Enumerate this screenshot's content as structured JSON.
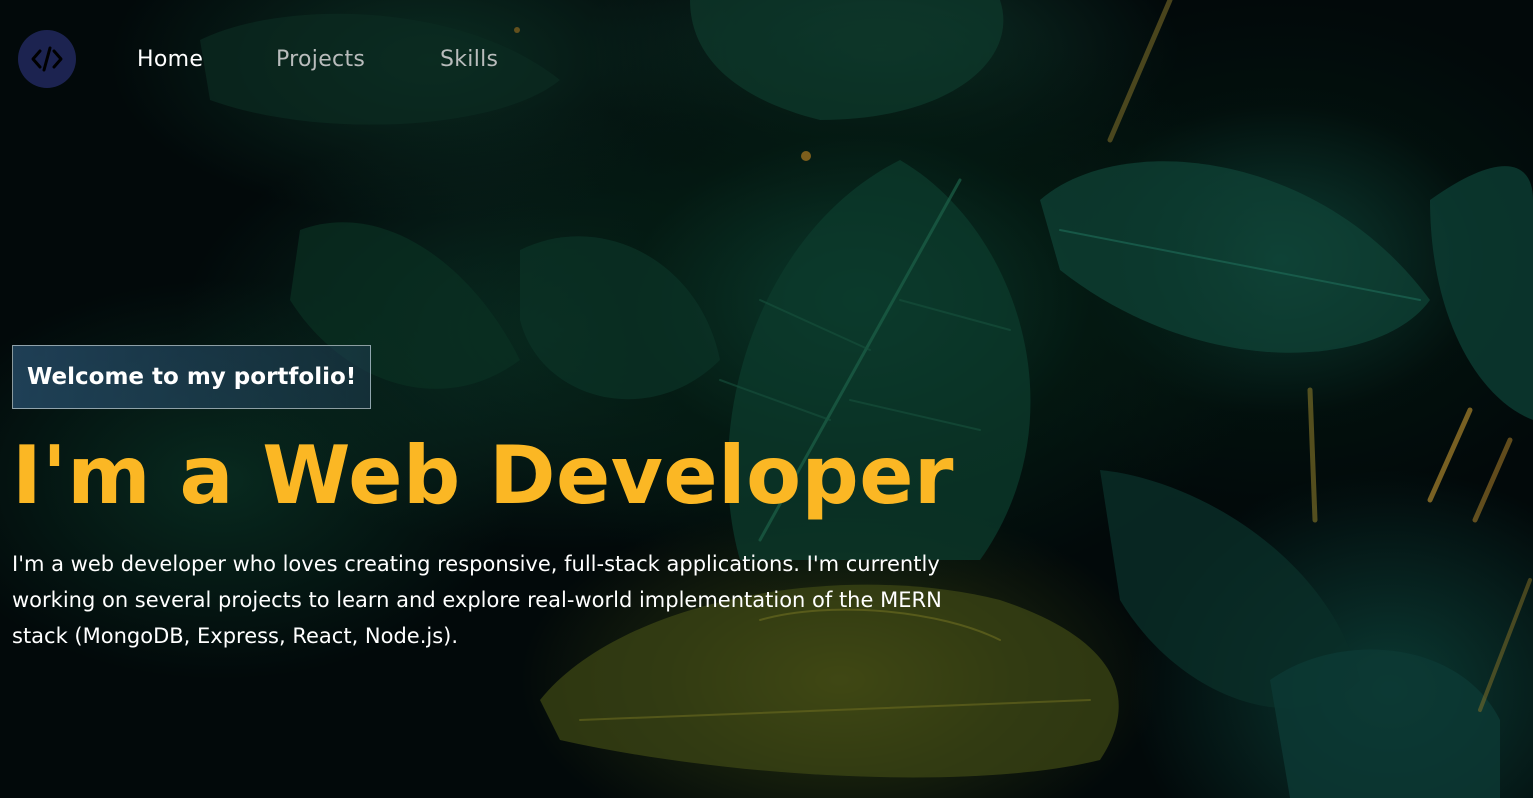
{
  "nav": {
    "logo_icon": "code-brackets-icon",
    "links": [
      {
        "label": "Home",
        "active": true
      },
      {
        "label": "Projects",
        "active": false
      },
      {
        "label": "Skills",
        "active": false
      }
    ]
  },
  "hero": {
    "tagline": "Welcome to my portfolio!",
    "headline": "I'm a Web Developer",
    "bio": "I'm a web developer who loves creating responsive, full-stack applications. I'm currently working on several projects to learn and explore real-world implementation of the MERN stack (MongoDB, Express, React, Node.js)."
  },
  "colors": {
    "accent": "#fbb724",
    "logo_bg": "#1c2350",
    "background": "#02090a",
    "nav_active": "#ffffff",
    "nav_inactive": "#b9bcbc"
  }
}
